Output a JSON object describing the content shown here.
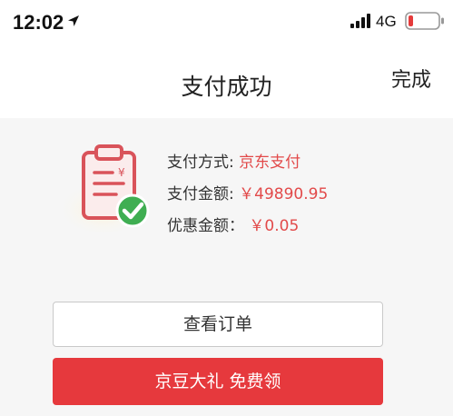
{
  "status_bar": {
    "time": "12:02",
    "network": "4G",
    "icons": [
      "location-arrow-icon",
      "cellular-signal-icon",
      "battery-icon"
    ]
  },
  "nav": {
    "title": "支付成功",
    "done_label": "完成"
  },
  "payment": {
    "method_label": "支付方式:",
    "method_value": "京东支付",
    "amount_label": "支付金额:",
    "amount_value": "￥49890.95",
    "discount_label": "优惠金额：",
    "discount_value": "￥0.05"
  },
  "illustration": {
    "icon": "clipboard-check-icon",
    "symbol": "¥"
  },
  "buttons": {
    "view_order": "查看订单",
    "jd_beans_gift": "京豆大礼 免费领"
  },
  "colors": {
    "accent_red": "#e6393d",
    "value_red": "#e24a4a",
    "success_green": "#3fae52"
  }
}
